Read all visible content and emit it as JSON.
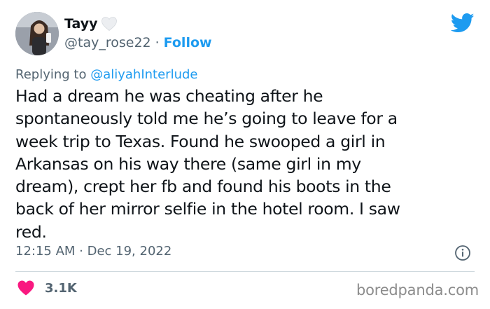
{
  "author": {
    "display_name": "Tayy",
    "name_emoji": "white-heart-icon",
    "handle": "@tay_rose22",
    "separator": "·",
    "follow_label": "Follow"
  },
  "reply": {
    "prefix": "Replying to ",
    "handle": "@aliyahInterlude"
  },
  "tweet": {
    "lines": [
      "Had a dream he was cheating after he",
      "spontaneously told me he’s going to leave for a",
      "week trip to Texas. Found he swooped a girl in",
      "Arkansas on his way there (same girl in my",
      "dream), crept her fb and found his boots in the",
      "back of her mirror selfie in the hotel room. I saw",
      "red."
    ]
  },
  "meta": {
    "timestamp": "12:15 AM · Dec 19, 2022"
  },
  "engagement": {
    "likes": "3.1K"
  },
  "watermark": "boredpanda.com",
  "colors": {
    "twitter_blue": "#1d9bf0",
    "like_pink": "#f91880",
    "muted_text": "#536471"
  },
  "icons": {
    "brand": "twitter-bird-icon",
    "info": "info-icon",
    "like": "heart-icon"
  }
}
